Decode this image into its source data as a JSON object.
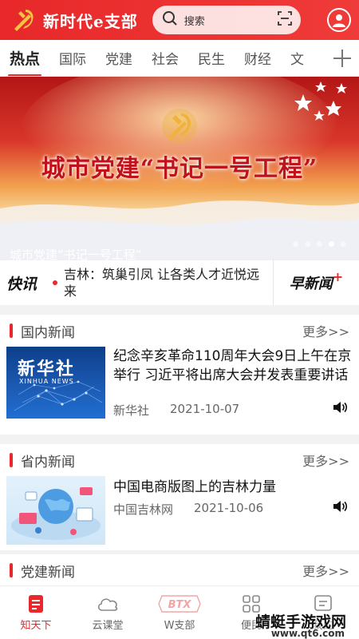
{
  "header": {
    "app_title": "新时代e支部",
    "search_placeholder": "搜索"
  },
  "tabs": [
    {
      "label": "热点",
      "active": true
    },
    {
      "label": "国际"
    },
    {
      "label": "党建"
    },
    {
      "label": "社会"
    },
    {
      "label": "民生"
    },
    {
      "label": "财经"
    },
    {
      "label": "文"
    }
  ],
  "banner": {
    "headline": "城市党建“书记一号工程”",
    "caption": "城市党建“书记一号工程”",
    "slide_count": 5,
    "active_slide": 4
  },
  "flash": {
    "label": "快讯",
    "text": "吉林：筑巢引凤 让各类人才近悦远来",
    "morning_label": "早新闻",
    "morning_plus": "+"
  },
  "sections": [
    {
      "title": "国内新闻",
      "more": "更多>>",
      "news": {
        "title": "纪念辛亥革命110周年大会9日上午在京举行 习近平将出席大会并发表重要讲话",
        "source": "新华社",
        "date": "2021-10-07",
        "thumb_text": "新华社",
        "thumb_sub": "XINHUA NEWS"
      }
    },
    {
      "title": "省内新闻",
      "more": "更多>>",
      "news": {
        "title": "中国电商版图上的吉林力量",
        "source": "中国吉林网",
        "date": "2021-10-06"
      }
    },
    {
      "title": "党建新闻",
      "more": "更多>>"
    }
  ],
  "bottom_nav": [
    {
      "label": "知天下",
      "active": true
    },
    {
      "label": "云课堂"
    },
    {
      "label": "W支部",
      "badge": "BTX"
    },
    {
      "label": "便民"
    },
    {
      "label": "我的"
    }
  ],
  "watermark": {
    "text": "蜻蜓手游戏网",
    "url": "www.qt6.com"
  },
  "colors": {
    "brand_red": "#e8282a",
    "gold": "#f6c243"
  }
}
